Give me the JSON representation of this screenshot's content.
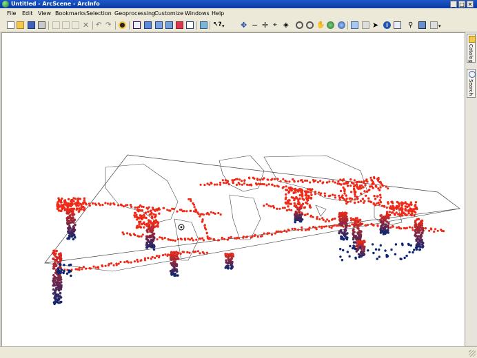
{
  "window": {
    "title": "Untitled - ArcScene - ArcInfo",
    "controls": {
      "minimize": "_",
      "maximize": "□",
      "close": "✕"
    }
  },
  "menu": {
    "items": [
      "File",
      "Edit",
      "View",
      "Bookmarks",
      "Selection",
      "Geoprocessing",
      "Customize",
      "Windows",
      "Help"
    ]
  },
  "toolbar": {
    "standard": [
      "new-document-icon",
      "open-folder-icon",
      "save-icon",
      "print-icon",
      "cut-icon",
      "copy-icon",
      "paste-icon",
      "delete-icon",
      "undo-icon",
      "redo-icon",
      "add-data-icon",
      "scene-properties-icon",
      "layer-icon",
      "layer-icon",
      "layer-icon",
      "window-icon",
      "model-builder-icon",
      "help-pointer-icon"
    ],
    "navigation": [
      "navigate-icon",
      "fly-icon",
      "center-target-icon",
      "zoom-to-target-icon",
      "set-observer-icon",
      "zoom-in-icon",
      "zoom-out-icon",
      "pan-icon",
      "full-extent-icon",
      "globe-icon",
      "select-features-icon",
      "clear-selection-icon",
      "select-elements-icon",
      "identify-icon",
      "html-popup-icon",
      "find-icon",
      "measure-icon",
      "scene-panel-icon"
    ]
  },
  "dock": {
    "tabs": [
      {
        "label": "Catalog",
        "icon": "catalog-icon"
      },
      {
        "label": "Search",
        "icon": "search-icon"
      }
    ]
  },
  "scene": {
    "colors": {
      "shallow": "#ee2a18",
      "deep": "#0b2672",
      "outline": "#444444",
      "background": "#ffffff"
    }
  }
}
